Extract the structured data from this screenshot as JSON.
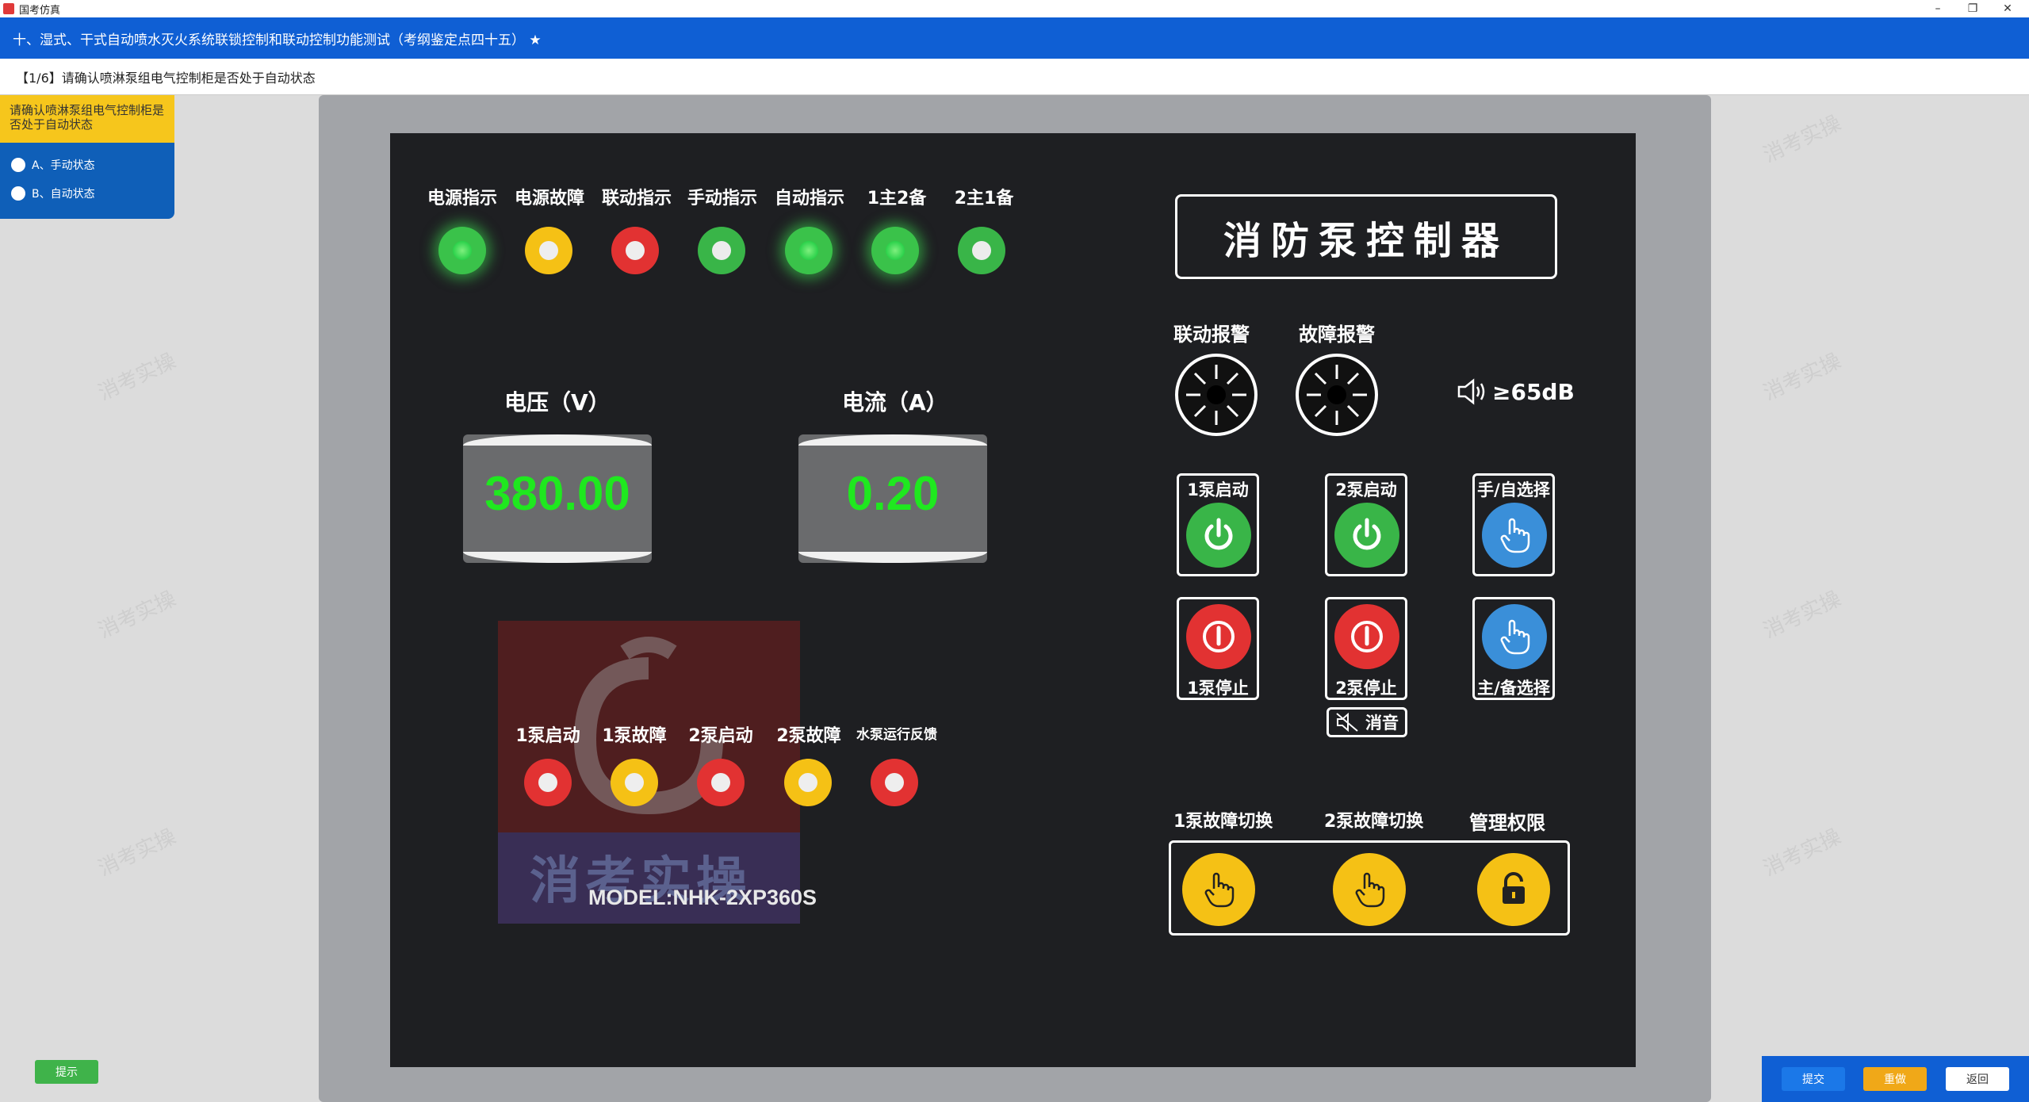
{
  "window": {
    "app_title": "国考仿真",
    "controls": [
      "–",
      "❐",
      "✕"
    ]
  },
  "header": {
    "title": "十、湿式、干式自动喷水灭火系统联锁控制和联动控制功能测试（考纲鉴定点四十五）  ★"
  },
  "question_bar": {
    "text": "【1/6】请确认喷淋泵组电气控制柜是否处于自动状态"
  },
  "left_panel": {
    "prompt": "请确认喷淋泵组电气控制柜是否处于自动状态",
    "options": [
      {
        "label": "A、手动状态"
      },
      {
        "label": "B、自动状态"
      }
    ]
  },
  "hint_button": "提示",
  "watermark": "消考实操",
  "controller": {
    "top_indicators": [
      {
        "label": "电源指示",
        "color": "green"
      },
      {
        "label": "电源故障",
        "color": "yellow"
      },
      {
        "label": "联动指示",
        "color": "red"
      },
      {
        "label": "手动指示",
        "color": "green-dim"
      },
      {
        "label": "自动指示",
        "color": "green"
      },
      {
        "label": "1主2备",
        "color": "green"
      },
      {
        "label": "2主1备",
        "color": "green-dim"
      }
    ],
    "voltage": {
      "title": "电压（V）",
      "value": "380.00"
    },
    "current": {
      "title": "电流（A）",
      "value": "0.20"
    },
    "brand_title": "消防泵控制器",
    "alarms": {
      "linkage": "联动报警",
      "fault": "故障报警",
      "volume": "≥65dB"
    },
    "buttons": {
      "pump1_start": "1泵启动",
      "pump2_start": "2泵启动",
      "manual_auto": "手/自选择",
      "pump1_stop": "1泵停止",
      "pump2_stop": "2泵停止",
      "main_backup": "主/备选择",
      "mute": "消音"
    },
    "bottom_indicators": [
      {
        "label": "1泵启动",
        "color": "red"
      },
      {
        "label": "1泵故障",
        "color": "yellow"
      },
      {
        "label": "2泵启动",
        "color": "red"
      },
      {
        "label": "2泵故障",
        "color": "yellow"
      },
      {
        "label": "水泵运行反馈",
        "color": "red"
      }
    ],
    "switches": {
      "pump1_fault_switch": "1泵故障切换",
      "pump2_fault_switch": "2泵故障切换",
      "admin": "管理权限"
    },
    "model": "MODEL:NHK-2XP360S",
    "overlay_text": "消考实操"
  },
  "footer": {
    "submit": "提交",
    "redo": "重做",
    "back": "返回"
  },
  "colors": {
    "header_blue": "#0f5fd4",
    "prompt_yellow": "#f6c61c",
    "panel_bg": "#1e1f22",
    "led_green": "#3ac24a",
    "led_red": "#e23232",
    "led_yellow": "#f5c115",
    "display_green": "#1fe81f"
  }
}
